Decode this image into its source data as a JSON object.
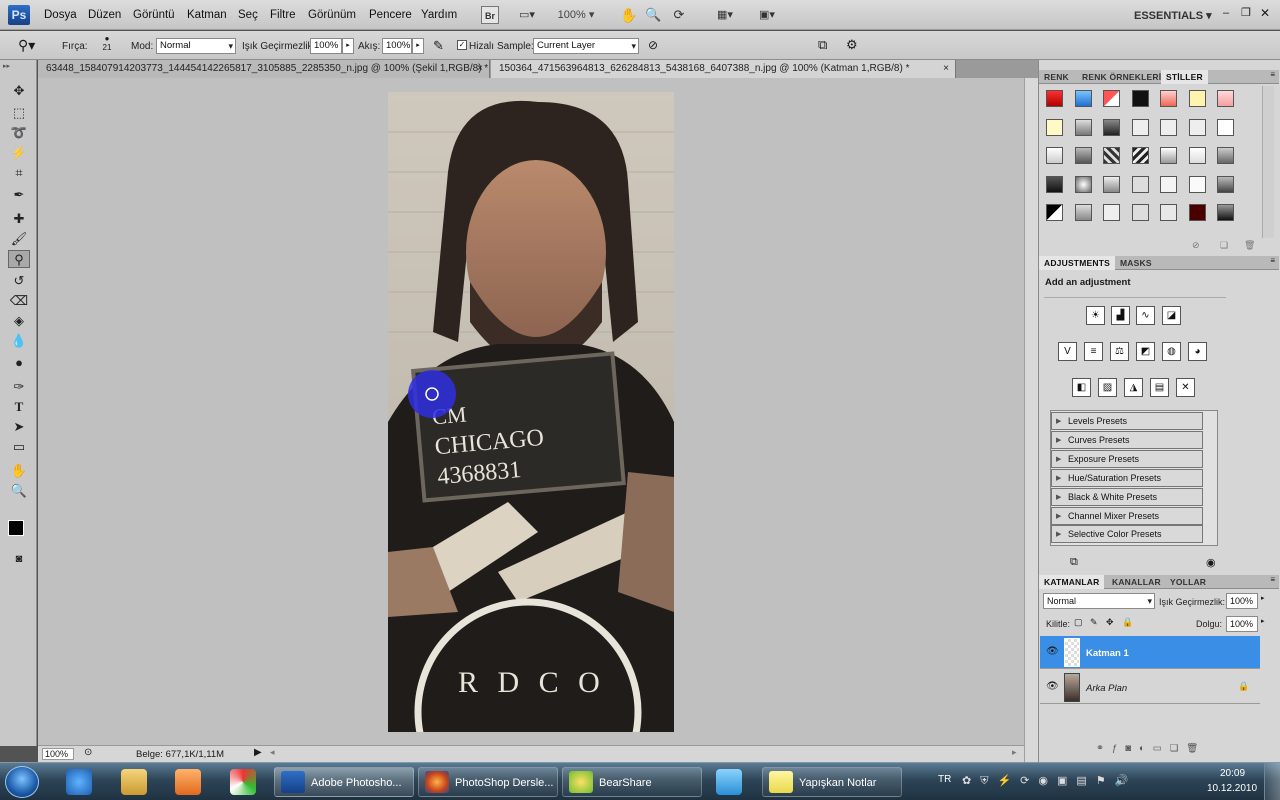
{
  "menubar": {
    "logo": "Ps",
    "items": [
      "Dosya",
      "Düzen",
      "Görüntü",
      "Katman",
      "Seç",
      "Filtre",
      "Görünüm",
      "Pencere",
      "Yardım"
    ],
    "br_label": "Br",
    "zoom": "100%",
    "workspace": "ESSENTIALS"
  },
  "options": {
    "brush_label": "Fırça:",
    "brush_size": "21",
    "mode_label": "Mod:",
    "mode_value": "Normal",
    "opacity_label": "Işık Geçirmezlik:",
    "opacity_value": "100%",
    "flow_label": "Akış:",
    "flow_value": "100%",
    "aligned_label": "Hizalı",
    "sample_label": "Sample:",
    "sample_value": "Current Layer"
  },
  "tabs": [
    {
      "label": "63448_158407914203773_144454142265817_3105885_2285350_n.jpg @ 100% (Şekil 1,RGB/8) *",
      "close": "×"
    },
    {
      "label": "150364_471563964813_626284813_5438168_6407388_n.jpg @ 100% (Katman 1,RGB/8) *",
      "close": "×"
    }
  ],
  "photo": {
    "line1": "CM",
    "line2": "CHICAGO",
    "line3": "4368831",
    "shirt_text": "R D C O"
  },
  "status": {
    "zoom": "100%",
    "doc_info": "Belge: 677,1K/1,11M"
  },
  "styles_panel": {
    "tabs": [
      "RENK",
      "RENK ÖRNEKLERİ",
      "STİLLER"
    ]
  },
  "adjustments_panel": {
    "tabs": [
      "ADJUSTMENTS",
      "MASKS"
    ],
    "heading": "Add an adjustment",
    "presets": [
      "Levels Presets",
      "Curves Presets",
      "Exposure Presets",
      "Hue/Saturation Presets",
      "Black & White Presets",
      "Channel Mixer Presets",
      "Selective Color Presets"
    ]
  },
  "layers_panel": {
    "tabs": [
      "KATMANLAR",
      "KANALLAR",
      "YOLLAR"
    ],
    "blend_mode": "Normal",
    "opacity_label": "Işık Geçirmezlik:",
    "opacity_value": "100%",
    "lock_label": "Kilitle:",
    "fill_label": "Dolgu:",
    "fill_value": "100%",
    "layers": [
      {
        "name": "Katman 1",
        "selected": true
      },
      {
        "name": "Arka Plan",
        "selected": false
      }
    ]
  },
  "taskbar": {
    "buttons": [
      "Adobe Photosho...",
      "PhotoShop Dersle...",
      "BearShare",
      "Yapışkan Notlar"
    ],
    "language": "TR",
    "time": "20:09",
    "date": "10.12.2010"
  }
}
